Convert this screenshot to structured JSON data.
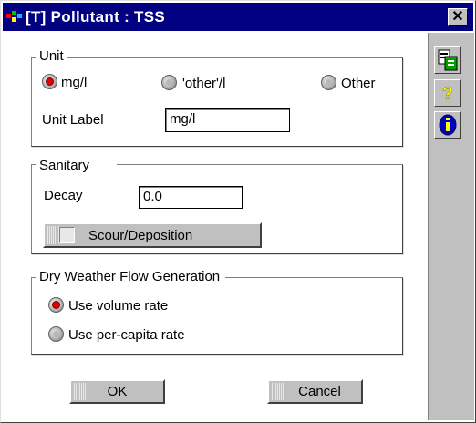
{
  "window": {
    "title": "[T] Pollutant : TSS"
  },
  "unit": {
    "legend": "Unit",
    "options": [
      "mg/l",
      "'other'/l",
      "Other"
    ],
    "selected": "mg/l",
    "label_caption": "Unit Label",
    "label_value": "mg/l"
  },
  "sanitary": {
    "legend": "Sanitary",
    "decay_caption": "Decay",
    "decay_value": "0.0",
    "scour_label": "Scour/Deposition"
  },
  "dwf": {
    "legend": "Dry Weather Flow Generation",
    "options": [
      "Use volume rate",
      "Use per-capita rate"
    ],
    "selected": "Use volume rate"
  },
  "buttons": {
    "ok": "OK",
    "cancel": "Cancel"
  },
  "sidebar": {
    "icons": [
      "copy-icon",
      "help-icon",
      "info-icon"
    ]
  },
  "colors": {
    "titlebar": "#000080",
    "radio_on": "#e00000",
    "help": "#ffff00",
    "info": "#0000c0"
  }
}
